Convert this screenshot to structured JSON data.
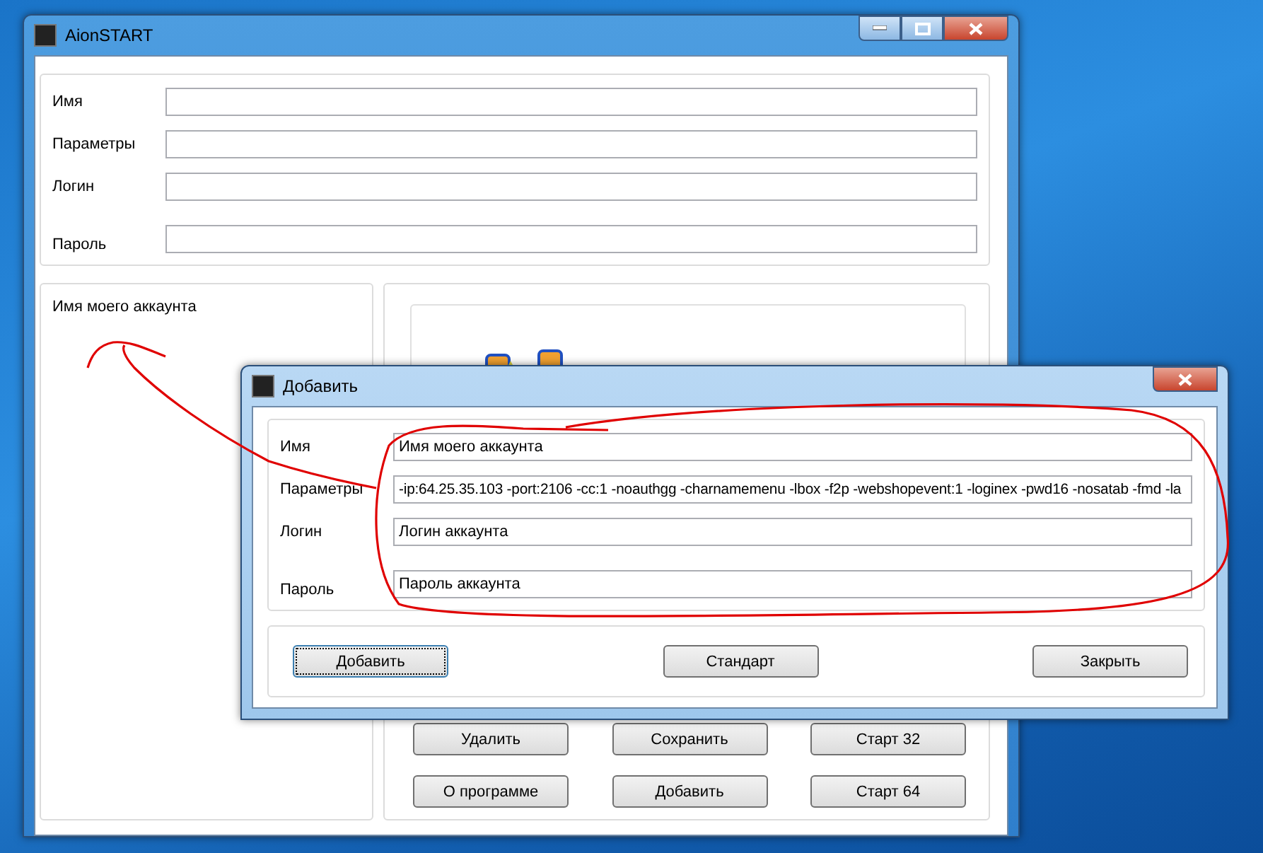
{
  "main_window": {
    "title": "AionSTART",
    "fields": [
      {
        "label": "Имя"
      },
      {
        "label": "Параметры"
      },
      {
        "label": "Логин"
      },
      {
        "label": "Пароль"
      }
    ],
    "accounts": [
      {
        "label": "Имя моего аккаунта"
      }
    ],
    "buttons": [
      "Удалить",
      "Сохранить",
      "Старт 32",
      "О программе",
      "Добавить",
      "Старт 64"
    ]
  },
  "dialog": {
    "title": "Добавить",
    "fields": [
      {
        "label": "Имя",
        "value": "Имя моего аккаунта"
      },
      {
        "label": "Параметры",
        "value": "-ip:64.25.35.103 -port:2106 -cc:1 -noauthgg -charnamemenu -lbox -f2p -webshopevent:1 -loginex -pwd16 -nosatab -fmd -la"
      },
      {
        "label": "Логин",
        "value": "Логин аккаунта"
      },
      {
        "label": "Пароль",
        "value": " Пароль аккаунта"
      }
    ],
    "buttons": [
      {
        "label": "Добавить",
        "focused": true
      },
      {
        "label": "Стандарт",
        "focused": false
      },
      {
        "label": "Закрыть",
        "focused": false
      }
    ]
  }
}
